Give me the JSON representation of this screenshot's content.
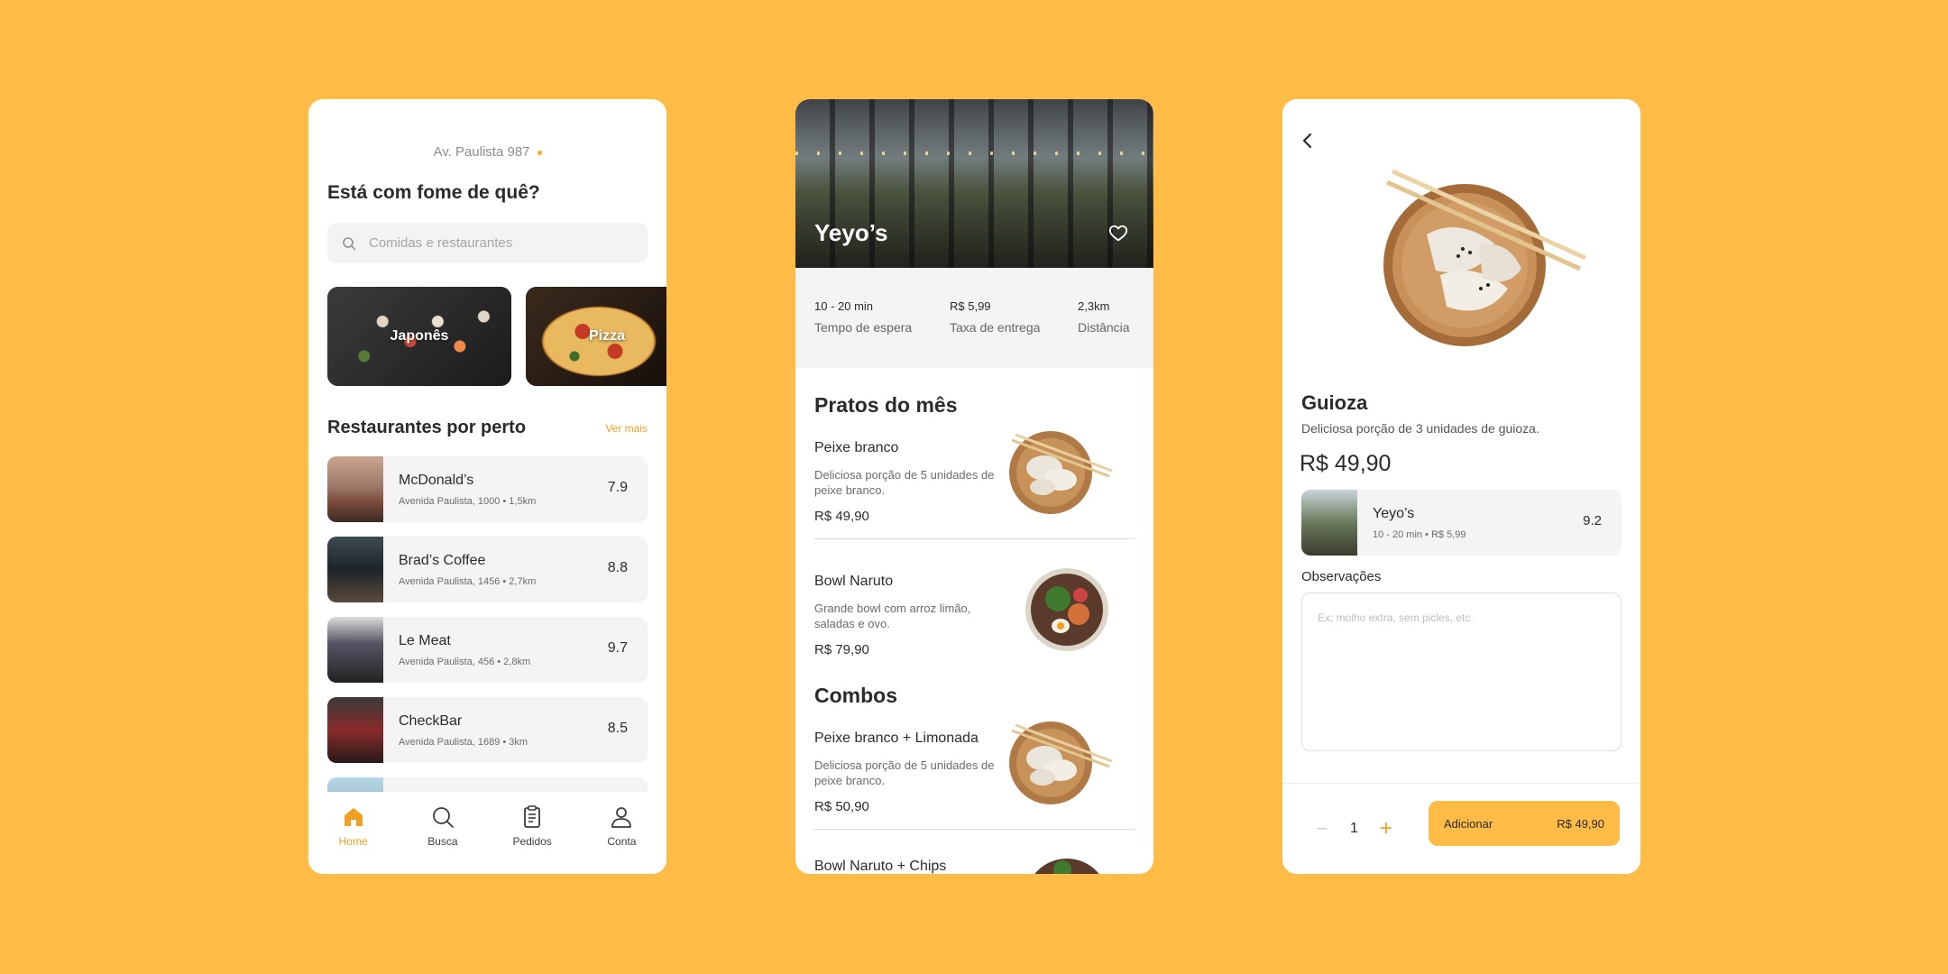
{
  "home": {
    "address": "Av. Paulista 987",
    "heading": "Está com fome de quê?",
    "search_placeholder": "Comidas e restaurantes",
    "categories": [
      {
        "label": "Japonês"
      },
      {
        "label": "Pizza"
      }
    ],
    "nearby_title": "Restaurantes por perto",
    "see_more": "Ver mais",
    "restaurants": [
      {
        "name": "McDonald’s",
        "address": "Avenida Paulista, 1000 • 1,5km",
        "score": "7.9"
      },
      {
        "name": "Brad’s Coffee",
        "address": "Avenida Paulista, 1456 • 2,7km",
        "score": "8.8"
      },
      {
        "name": "Le Meat",
        "address": "Avenida Paulista, 456 • 2,8km",
        "score": "9.7"
      },
      {
        "name": "CheckBar",
        "address": "Avenida Paulista, 1689 • 3km",
        "score": "8.5"
      }
    ],
    "tabs": [
      {
        "label": "Home",
        "icon": "home-icon",
        "active": true
      },
      {
        "label": "Busca",
        "icon": "search-icon"
      },
      {
        "label": "Pedidos",
        "icon": "orders-icon"
      },
      {
        "label": "Conta",
        "icon": "account-icon"
      }
    ]
  },
  "restaurant": {
    "name": "Yeyo’s",
    "stats": [
      {
        "value": "10 - 20 min",
        "label": "Tempo de espera"
      },
      {
        "value": "R$ 5,99",
        "label": "Taxa de entrega"
      },
      {
        "value": "2,3km",
        "label": "Distância"
      }
    ],
    "section_month": "Pratos do mês",
    "section_combos": "Combos",
    "dishes": [
      {
        "name": "Peixe branco",
        "desc": "Deliciosa porção de 5 unidades de peixe branco.",
        "price": "R$ 49,90"
      },
      {
        "name": "Bowl Naruto",
        "desc": "Grande bowl com arroz limão, saladas e ovo.",
        "price": "R$ 79,90"
      }
    ],
    "combos": [
      {
        "name": "Peixe branco + Limonada",
        "desc": "Deliciosa porção de 5 unidades de peixe branco.",
        "price": "R$ 50,90"
      },
      {
        "name": "Bowl Naruto + Chips"
      }
    ]
  },
  "product": {
    "name": "Guioza",
    "description": "Deliciosa porção de 3 unidades de guioza.",
    "price": "R$ 49,90",
    "restaurant": {
      "name": "Yeyo’s",
      "info": "10 - 20 min • R$ 5,99",
      "score": "9.2"
    },
    "notes_label": "Observações",
    "notes_placeholder": "Ex: molho extra, sem picles, etc.",
    "quantity": "1",
    "minus": "−",
    "plus": "+",
    "add_label": "Adicionar",
    "add_price": "R$ 49,90"
  },
  "colors": {
    "background": "#FFBC47",
    "accent": "#F0A020"
  }
}
